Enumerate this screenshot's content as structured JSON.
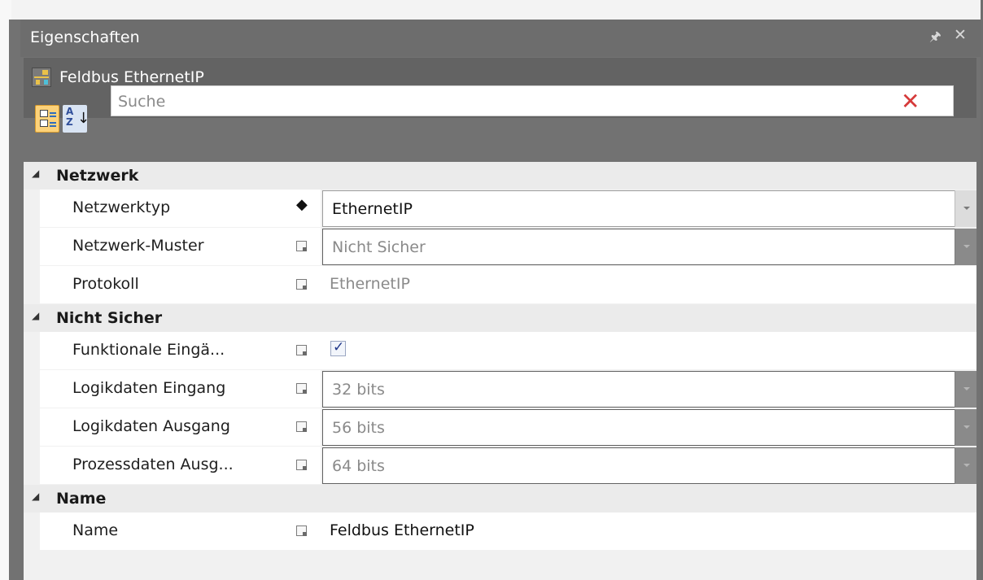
{
  "panel": {
    "title": "Eigenschaften",
    "pin_icon": "pin-icon",
    "close_icon": "close-icon",
    "pin_glyph": "ₕ",
    "close_glyph": "✕"
  },
  "object": {
    "title": "Feldbus EthernetIP",
    "icon": "fieldbus-icon"
  },
  "toolbar": {
    "categorized_icon": "categorized-view-icon",
    "alphabetical_icon": "sort-alphabetical-icon",
    "az_text": "A\nZ",
    "arrow": "↓",
    "search_placeholder": "Suche",
    "clear_glyph": "✕"
  },
  "categories": [
    {
      "label": "Netzwerk",
      "rows": [
        {
          "name": "Netzwerktyp",
          "marker": "diamond",
          "value": "EthernetIP",
          "style": "dropdown-active"
        },
        {
          "name": "Netzwerk-Muster",
          "marker": "box",
          "value": "Nicht Sicher",
          "style": "dropdown-disabled"
        },
        {
          "name": "Protokoll",
          "marker": "box",
          "value": "EthernetIP",
          "style": "readonly"
        }
      ]
    },
    {
      "label": "Nicht Sicher",
      "rows": [
        {
          "name": "Funktionale Eingä...",
          "marker": "box",
          "value": true,
          "style": "checkbox"
        },
        {
          "name": "Logikdaten Eingang",
          "marker": "box",
          "value": "32 bits",
          "style": "dropdown-disabled"
        },
        {
          "name": "Logikdaten Ausgang",
          "marker": "box",
          "value": "56 bits",
          "style": "dropdown-disabled"
        },
        {
          "name": "Prozessdaten Ausg...",
          "marker": "box",
          "value": "64 bits",
          "style": "dropdown-disabled"
        }
      ]
    },
    {
      "label": "Name",
      "rows": [
        {
          "name": "Name",
          "marker": "box",
          "value": "Feldbus EthernetIP",
          "style": "text"
        }
      ]
    }
  ]
}
